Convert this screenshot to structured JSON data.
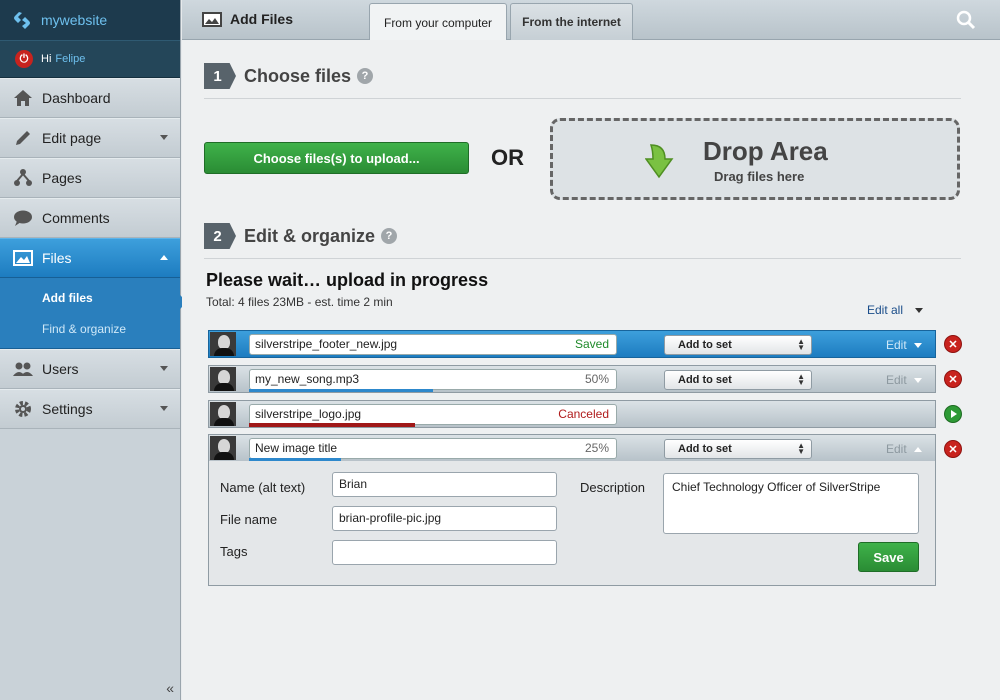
{
  "brand": {
    "name": "mywebsite"
  },
  "user": {
    "greeting": "Hi",
    "name": "Felipe"
  },
  "sidebar": {
    "items": [
      {
        "label": "Dashboard"
      },
      {
        "label": "Edit page"
      },
      {
        "label": "Pages"
      },
      {
        "label": "Comments"
      },
      {
        "label": "Files"
      },
      {
        "label": "Users"
      },
      {
        "label": "Settings"
      }
    ],
    "subitems": [
      {
        "label": "Add files"
      },
      {
        "label": "Find & organize"
      }
    ],
    "collapse": "«"
  },
  "header": {
    "title": "Add Files",
    "tabs": [
      {
        "label": "From your computer"
      },
      {
        "label": "From the internet"
      }
    ]
  },
  "steps": [
    {
      "num": "1",
      "label": "Choose files",
      "help": "?"
    },
    {
      "num": "2",
      "label": "Edit & organize",
      "help": "?"
    }
  ],
  "upload": {
    "choose_label": "Choose files(s) to upload...",
    "or": "OR",
    "drop_title": "Drop Area",
    "drop_sub": "Drag files here"
  },
  "progress": {
    "title": "Please wait… upload in progress",
    "total": "Total: 4 files 23MB - est. time 2 min",
    "edit_all": "Edit all"
  },
  "files": [
    {
      "name": "silverstripe_footer_new.jpg",
      "status": "Saved",
      "progress": 1.0,
      "set": "Add to set",
      "edit": "Edit"
    },
    {
      "name": "my_new_song.mp3",
      "status": "50%",
      "progress": 0.5,
      "set": "Add to set",
      "edit": "Edit"
    },
    {
      "name": "silverstripe_logo.jpg",
      "status": "Canceled",
      "progress": 0.45
    },
    {
      "name": "New image title",
      "status": "25%",
      "progress": 0.25,
      "set": "Add to set",
      "edit": "Edit"
    }
  ],
  "form": {
    "name_label": "Name (alt text)",
    "name_value": "Brian",
    "file_label": "File name",
    "file_value": "brian-profile-pic.jpg",
    "tags_label": "Tags",
    "tags_value": "",
    "desc_label": "Description",
    "desc_value": "Chief Technology Officer of SilverStripe",
    "save_label": "Save"
  },
  "colors": {
    "accent": "#2a7fbd",
    "green": "#2f9e3a",
    "danger": "#c8231e",
    "saved": "#1f8a2a",
    "canceled": "#b01c1c"
  }
}
